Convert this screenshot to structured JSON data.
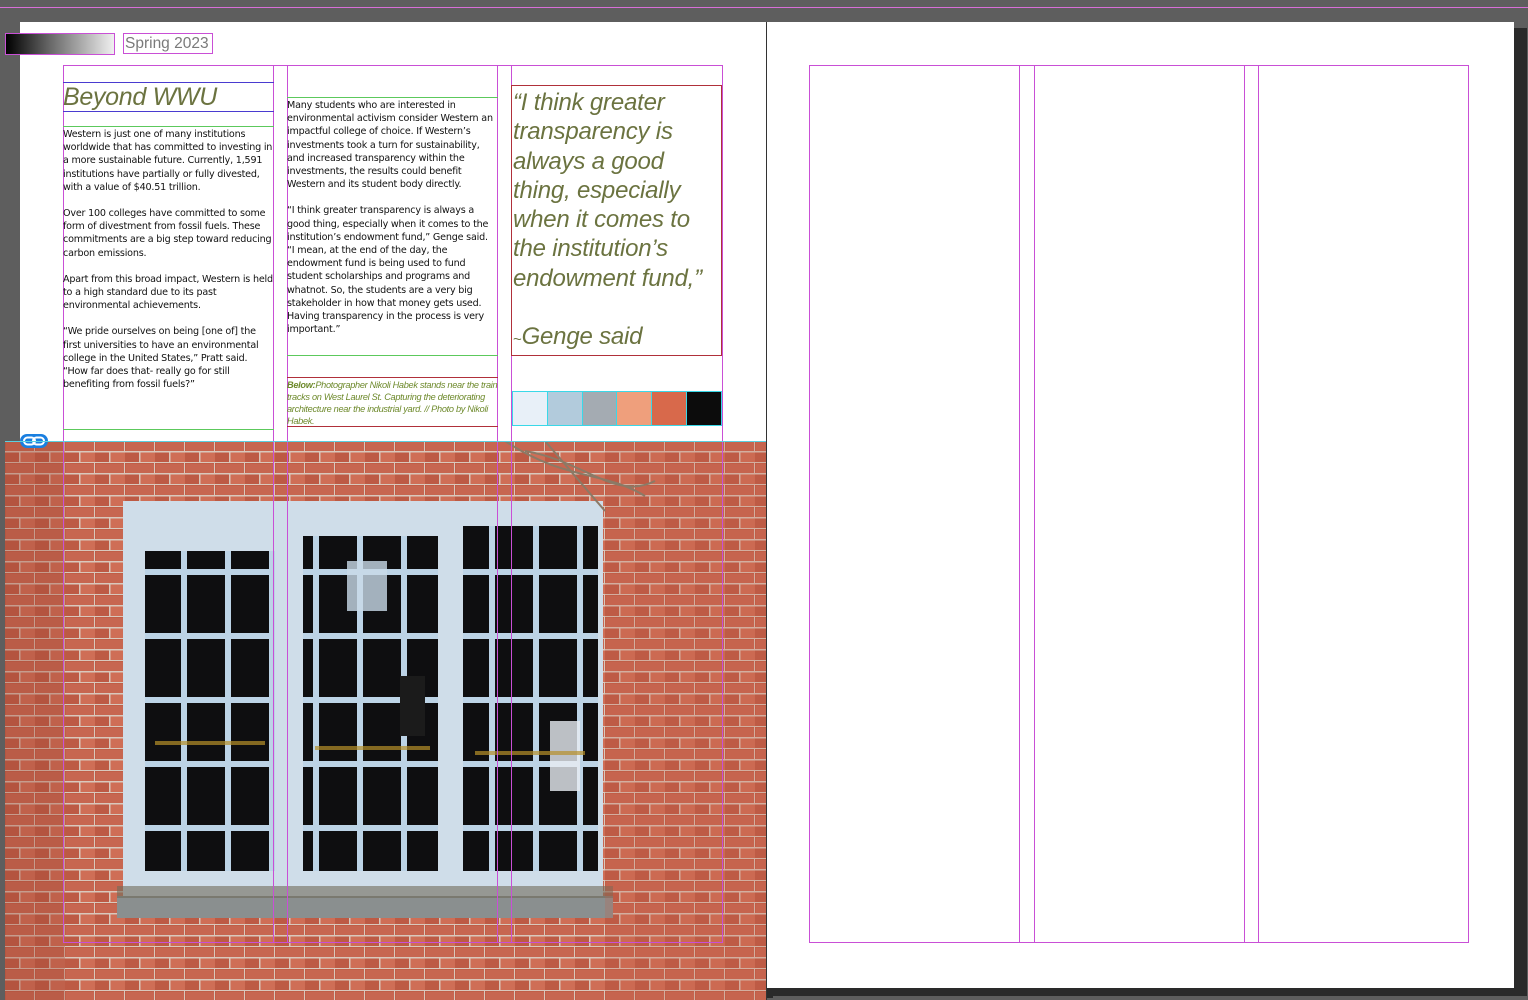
{
  "issue_label": "Spring 2023",
  "headline": "Beyond WWU",
  "column1": [
    "Western is just one of many institutions worldwide that has committed to investing in a more sustainable future. Currently, 1,591 institutions have partially or fully divested, with a value of $40.51 trillion.",
    "Over 100 colleges have committed to some form of divestment from fossil fuels. These commitments are a big step toward reducing carbon emissions.",
    "Apart from this broad impact, Western is held to a high standard due to its past environmental achievements.",
    "“We pride ourselves on being [one of] the first universities to have an environmental college in the United States,” Pratt said. “How far does that- really go for still benefiting from fossil fuels?”"
  ],
  "column2": [
    "Many students who are interested in environmental activism consider Western an impactful college of choice. If Western’s investments took a turn for sustainability, and increased transparency within the investments, the results could benefit Western and its student body directly.",
    "“I think greater transparency is always a good thing, especially when it comes to the institution’s endowment fund,” Genge said. “I mean, at the end of the day, the endowment fund is being used to fund student scholarships and programs and whatnot. So, the students are a very big stakeholder in how that money gets used. Having transparency in the process is very important.”"
  ],
  "caption": {
    "lead": "Below:",
    "text": "Photographer Nikoli Habek stands near the train tracks on West Laurel St. Capturing the deteriorating architecture near the industrial yard. // Photo by Nikoli Habek."
  },
  "pull_quote": {
    "quote": "“I think greater transparency is always a good thing, especially when it comes to the institution’s endowment fund,”",
    "tilde": "~",
    "attribution": "Genge said"
  },
  "swatches": [
    "#e8f0f8",
    "#b2cbdc",
    "#a4abb2",
    "#ef9f7c",
    "#d8694b",
    "#0c0c0c"
  ],
  "colors": {
    "headline": "#6b7340",
    "pasteboard": "#5e5e5e",
    "guide": "#c94fd6",
    "link_badge": "#1a7fe0"
  },
  "icons": {
    "link": "link-icon",
    "gradient": "gradient-swatch"
  }
}
